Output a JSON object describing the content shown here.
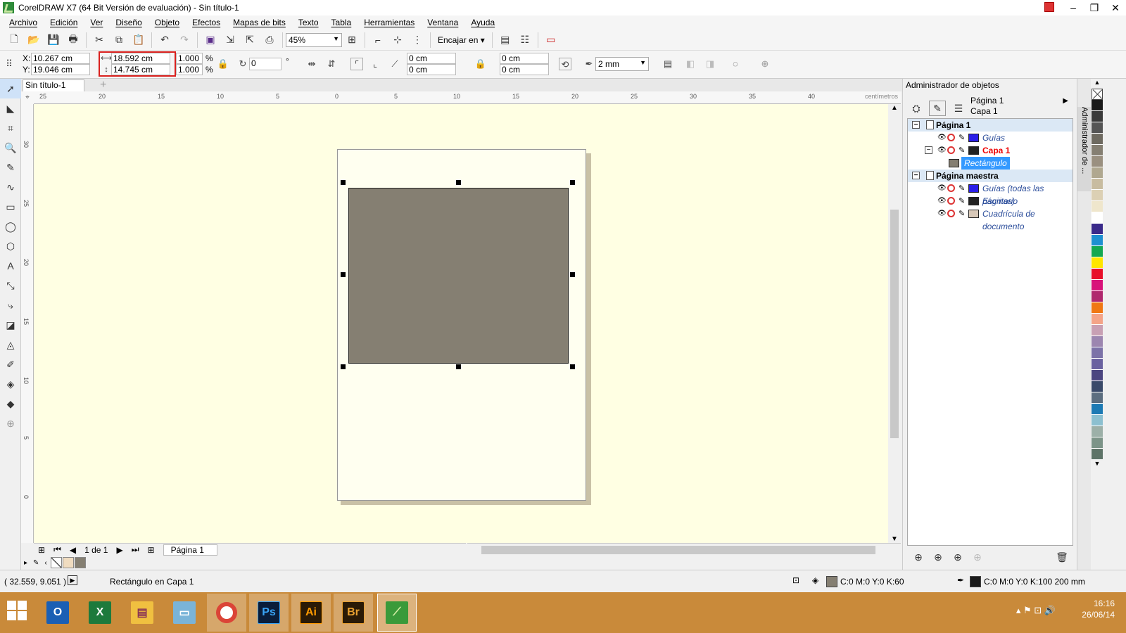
{
  "window": {
    "title": "CorelDRAW X7 (64 Bit Versión de evaluación) - Sin título-1",
    "controls": [
      "–",
      "❐",
      "✕"
    ]
  },
  "menu": [
    "Archivo",
    "Edición",
    "Ver",
    "Diseño",
    "Objeto",
    "Efectos",
    "Mapas de bits",
    "Texto",
    "Tabla",
    "Herramientas",
    "Ventana",
    "Ayuda"
  ],
  "toolbar": {
    "zoom_value": "45%",
    "snap_label": "Encajar en"
  },
  "propbar": {
    "x_label": "X:",
    "x_value": "10.267 cm",
    "y_label": "Y:",
    "y_value": "19.046 cm",
    "width_value": "18.592 cm",
    "height_value": "14.745 cm",
    "scale_w": "1.000",
    "scale_h": "1.000",
    "percent_symbol": "%",
    "rotation_value": "0",
    "degree_symbol": "°",
    "corner_1": "0 cm",
    "corner_2": "0 cm",
    "corner_3": "0 cm",
    "corner_4": "0 cm",
    "outline_width": "2 mm"
  },
  "document": {
    "tab_name": "Sin título-1",
    "add_tab": "+",
    "ruler_unit": "centímetros",
    "page_counter": "1 de 1",
    "page_tab": "Página 1"
  },
  "ruler": {
    "h_labels": [
      "25",
      "20",
      "15",
      "10",
      "5",
      "0",
      "5",
      "10",
      "15",
      "20",
      "25",
      "30",
      "35",
      "40"
    ],
    "v_labels": [
      "30",
      "25",
      "20",
      "15",
      "10",
      "5",
      "0"
    ]
  },
  "shape": {
    "fill_color": "#857f72",
    "page_color": "#fffff0",
    "desktop_color": "#ffffe3"
  },
  "object_manager": {
    "title": "Administrador de objetos",
    "context_page": "Página 1",
    "context_layer": "Capa 1",
    "tree": [
      {
        "label": "Página 1",
        "kind": "page"
      },
      {
        "label": "Guías",
        "kind": "layer",
        "color": "#2a1ee8"
      },
      {
        "label": "Capa 1",
        "kind": "active-layer",
        "color": "#222222"
      },
      {
        "label": "Rectángulo",
        "kind": "object",
        "color": "#857f72"
      },
      {
        "label": "Página maestra",
        "kind": "page"
      },
      {
        "label": "Guías (todas las páginas)",
        "kind": "layer",
        "color": "#2a1ee8"
      },
      {
        "label": "Escritorio",
        "kind": "layer",
        "color": "#222222"
      },
      {
        "label": "Cuadrícula de documento",
        "kind": "layer",
        "color": "#d8c8b8"
      }
    ]
  },
  "docker_tab": "Administrador de ...",
  "palette_colors": [
    "#1a1a1a",
    "#3a3a3a",
    "#555555",
    "#6e6a60",
    "#857f72",
    "#9a9080",
    "#b0a890",
    "#c8bca0",
    "#dcd0b4",
    "#efe6cc",
    "#ffffff",
    "#3a2a8a",
    "#1e90d0",
    "#14a850",
    "#ffe600",
    "#e8102a",
    "#d8127a",
    "#b0286e",
    "#f07814",
    "#f4a488",
    "#c8a0b4",
    "#9c86b0",
    "#7c72a8",
    "#6a62a0",
    "#4c4680",
    "#3a4a6a",
    "#5c6e80",
    "#1c7ab4",
    "#8cc0d0",
    "#9cb0a8",
    "#7c9488",
    "#5e7468"
  ],
  "document_palette": [
    "none",
    "#f0dcc0",
    "#857f72"
  ],
  "status": {
    "coords": "( 32.559, 9.051 )",
    "selection": "Rectángulo en Capa 1",
    "fill_swatch": "#857f72",
    "fill_label": "C:0 M:0 Y:0 K:60",
    "outline_swatch": "#1a1a1a",
    "outline_label": "C:0 M:0 Y:0 K:100  200 mm"
  },
  "taskbar": {
    "apps": [
      "Outlook",
      "Excel",
      "Explorer",
      "Files",
      "Chrome",
      "Ps",
      "Ai",
      "Br",
      "CorelDRAW"
    ],
    "time": "16:16",
    "date": "26/06/14"
  }
}
